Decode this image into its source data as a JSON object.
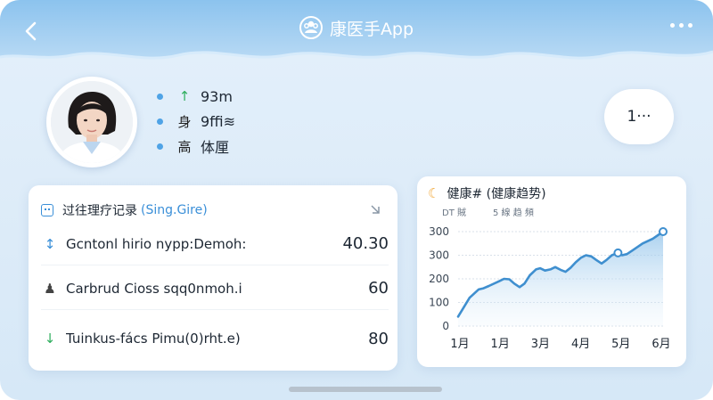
{
  "header": {
    "title": "康医手App",
    "back_icon": "chevron-left-icon",
    "logo_icon": "medical-logo-icon",
    "more_icon": "more-dots-icon"
  },
  "profile": {
    "avatar_icon": "doctor-avatar",
    "rows": [
      {
        "icon": "↑",
        "icon_name": "height-arrow-icon",
        "label": "93m"
      },
      {
        "icon": "身",
        "icon_name": "body-icon",
        "label": "9ffi≋"
      },
      {
        "icon": "高",
        "icon_name": "height-icon",
        "label": "体厘"
      }
    ],
    "circle_button_label": "1···"
  },
  "records": {
    "title": "过往理疗记录",
    "subtitle": "(Sing.Gire)",
    "expand_icon": "expand-arrow-icon",
    "rows": [
      {
        "icon": "↕",
        "icon_name": "updown-arrow-icon",
        "color": "#3a8fd8",
        "label": "Gcntonl hirio nypp:Demoh:",
        "value": "40.30"
      },
      {
        "icon": "♟",
        "icon_name": "figure-icon",
        "color": "#444444",
        "label": "Carbrud Cioss sqq0nmoh.i",
        "value": "60"
      },
      {
        "icon": "↓",
        "icon_name": "down-arrow-icon",
        "color": "#2fae5e",
        "label": "Tuinkus-fács Pimu(0)rht.e)",
        "value": "80"
      }
    ]
  },
  "trend": {
    "title": "健康# (健康趋势)",
    "moon_icon": "moon-icon",
    "legend": [
      "DT 賊",
      "5 線 趋 頻"
    ]
  },
  "chart_data": {
    "type": "area",
    "title": "健康# (健康趋势)",
    "categories": [
      "1月",
      "1月",
      "3月",
      "4月",
      "5月",
      "6月"
    ],
    "x": [
      0,
      0.28,
      0.5,
      0.62,
      0.75,
      1.0,
      1.12,
      1.25,
      1.37,
      1.5,
      1.62,
      1.75,
      1.9,
      2.0,
      2.12,
      2.25,
      2.37,
      2.5,
      2.62,
      2.75,
      2.87,
      3.0,
      3.12,
      3.25,
      3.37,
      3.5,
      3.62,
      3.75,
      3.9,
      4.0,
      4.12,
      4.25,
      4.5,
      4.75,
      5.0
    ],
    "values": [
      40,
      120,
      155,
      160,
      170,
      190,
      200,
      198,
      180,
      165,
      180,
      215,
      240,
      245,
      235,
      240,
      250,
      238,
      230,
      248,
      270,
      290,
      300,
      295,
      280,
      265,
      280,
      300,
      310,
      300,
      305,
      320,
      350,
      370,
      400
    ],
    "markers": [
      {
        "x": 3.9,
        "y": 310
      },
      {
        "x": 5.0,
        "y": 400
      }
    ],
    "yticks": [
      0,
      100,
      200,
      300,
      300
    ],
    "ylim": [
      0,
      400
    ],
    "color": "#3f8fcf"
  },
  "colors": {
    "header_top": "#8fc5ef",
    "header_bottom": "#b9dbf5",
    "accent": "#3a8fd8",
    "green": "#2fae5e"
  }
}
